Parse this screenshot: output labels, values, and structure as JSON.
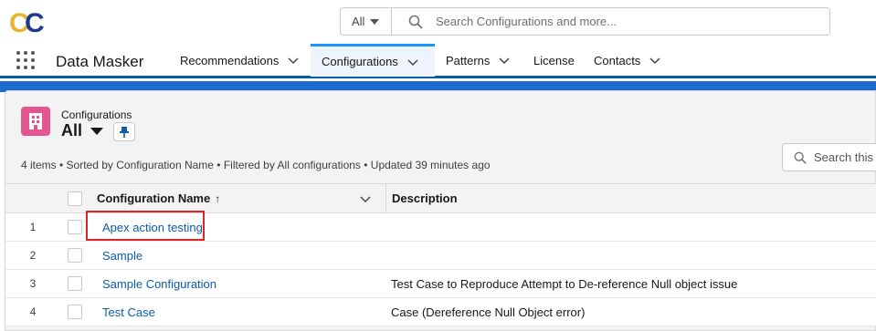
{
  "global_header": {
    "logo_text": "CC",
    "search": {
      "scope_label": "All",
      "placeholder": "Search Configurations and more..."
    }
  },
  "nav": {
    "app_name": "Data Masker",
    "items": [
      {
        "label": "Recommendations",
        "has_menu": true
      },
      {
        "label": "Configurations",
        "has_menu": true,
        "active": true
      },
      {
        "label": "Patterns",
        "has_menu": true
      },
      {
        "label": "License",
        "has_menu": false
      },
      {
        "label": "Contacts",
        "has_menu": true
      }
    ]
  },
  "list_view": {
    "object_label": "Configurations",
    "view_name": "All",
    "meta": "4 items • Sorted by Configuration Name • Filtered by All configurations • Updated 39 minutes ago",
    "search_placeholder": "Search this li"
  },
  "table": {
    "columns": [
      {
        "label": "Configuration Name",
        "sort": "↑"
      },
      {
        "label": "Description"
      }
    ],
    "rows": [
      {
        "num": "1",
        "name": "Apex action testing",
        "description": ""
      },
      {
        "num": "2",
        "name": "Sample",
        "description": ""
      },
      {
        "num": "3",
        "name": "Sample Configuration",
        "description": "Test Case to Reproduce Attempt to De-reference Null object issue"
      },
      {
        "num": "4",
        "name": "Test Case",
        "description": "Case (Dereference Null Object error)"
      }
    ]
  },
  "colors": {
    "brand_blue": "#0b5cab",
    "nav_active_bar": "#1b96ff",
    "object_icon": "#e3568f",
    "highlight": "#e0232b",
    "logo_gold": "#e8b530",
    "logo_blue": "#1e3a8a"
  }
}
